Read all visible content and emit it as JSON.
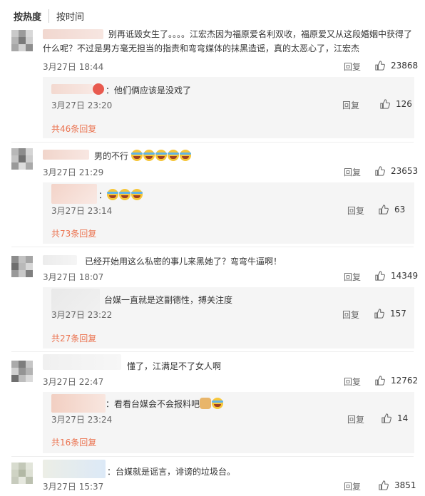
{
  "sort": {
    "hot": "按热度",
    "time": "按时间"
  },
  "comments": [
    {
      "text": "别再诋毁女生了。。。。江宏杰因为福原爱名利双收，福原爱又从这段婚姻中获得了什么呢？不过是男方毫无担当的指责和弯弯媒体的抹黑造谣，真的太恶心了，江宏杰",
      "date": "3月27日 18:44",
      "reply": "回复",
      "likes": "23868",
      "sub_text": "：他们俩应该是没戏了",
      "sub_date": "3月27日 23:20",
      "sub_reply": "回复",
      "sub_likes": "126",
      "more": "共46条回复"
    },
    {
      "text": "男的不行",
      "date": "3月27日 21:29",
      "reply": "回复",
      "likes": "23653",
      "sub_text": "：",
      "sub_date": "3月27日 23:14",
      "sub_reply": "回复",
      "sub_likes": "63",
      "more": "共73条回复"
    },
    {
      "text": "已经开始用这么私密的事儿来黑她了？弯弯牛逼啊！",
      "date": "3月27日 18:07",
      "reply": "回复",
      "likes": "14349",
      "sub_text": "台媒一直就是这副德性，搏关注度",
      "sub_date": "3月27日 23:22",
      "sub_reply": "回复",
      "sub_likes": "157",
      "more": "共27条回复"
    },
    {
      "text": "懂了，江满足不了女人啊",
      "date": "3月27日 22:47",
      "reply": "回复",
      "likes": "12762",
      "sub_text": "：看看台媒会不会报料吧",
      "sub_date": "3月27日 23:24",
      "sub_reply": "回复",
      "sub_likes": "14",
      "more": "共16条回复"
    },
    {
      "text": "：台媒就是谣言，诽谤的垃圾台。",
      "date": "3月27日 15:37",
      "reply": "回复",
      "likes": "3851"
    }
  ]
}
